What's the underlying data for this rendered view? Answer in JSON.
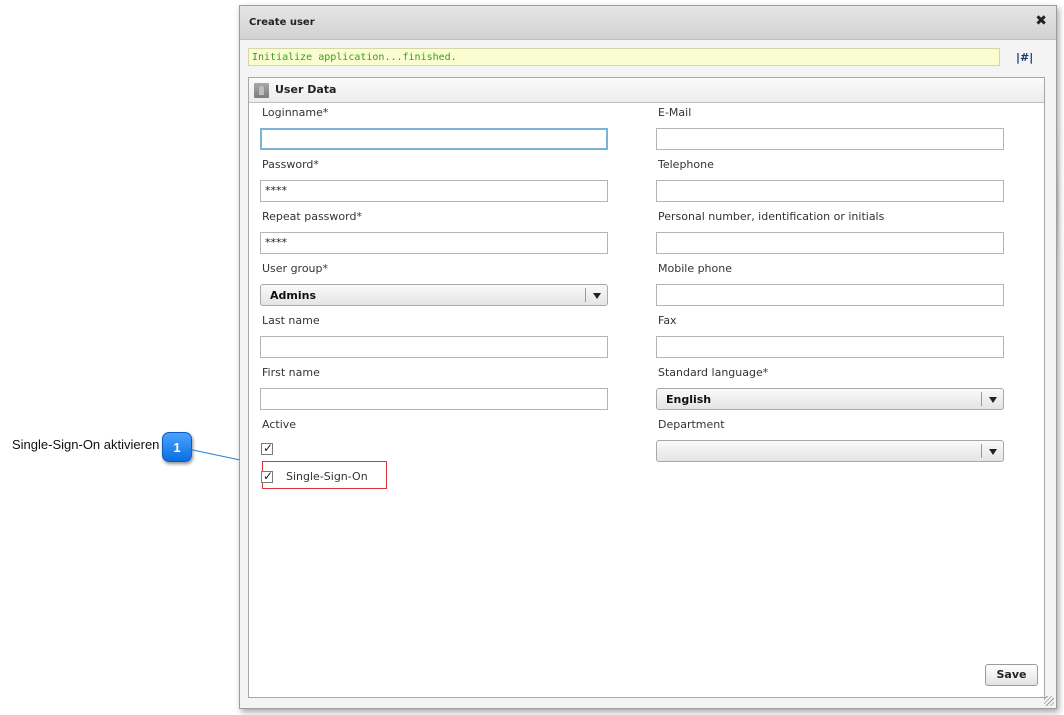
{
  "annotation": {
    "text": "Single-Sign-On aktivieren",
    "badge": "1"
  },
  "dialog": {
    "title": "Create user",
    "status_text": "Initialize application...finished.",
    "hash_link": "|#|"
  },
  "panel": {
    "title": "User Data"
  },
  "form": {
    "left": {
      "loginname_label": "Loginname*",
      "loginname_value": "",
      "password_label": "Password*",
      "password_value": "****",
      "repeat_password_label": "Repeat password*",
      "repeat_password_value": "****",
      "user_group_label": "User group*",
      "user_group_value": "Admins",
      "last_name_label": "Last name",
      "last_name_value": "",
      "first_name_label": "First name",
      "first_name_value": "",
      "active_label": "Active",
      "active_checked": true,
      "sso_label": "Single-Sign-On",
      "sso_checked": true
    },
    "right": {
      "email_label": "E-Mail",
      "email_value": "",
      "telephone_label": "Telephone",
      "telephone_value": "",
      "personal_number_label": "Personal number, identification or initials",
      "personal_number_value": "",
      "mobile_label": "Mobile phone",
      "mobile_value": "",
      "fax_label": "Fax",
      "fax_value": "",
      "language_label": "Standard language*",
      "language_value": "English",
      "department_label": "Department",
      "department_value": ""
    }
  },
  "buttons": {
    "save_label": "Save"
  },
  "icons": {
    "close": "close-icon",
    "user": "user-icon",
    "checkmark": "✓"
  },
  "colors": {
    "status_text": "#3a9c1e",
    "status_bg": "#fafdd2",
    "highlight_border": "#d8353b",
    "badge_blue": "#0b6ee0",
    "focus_border": "#7bb3d6"
  }
}
